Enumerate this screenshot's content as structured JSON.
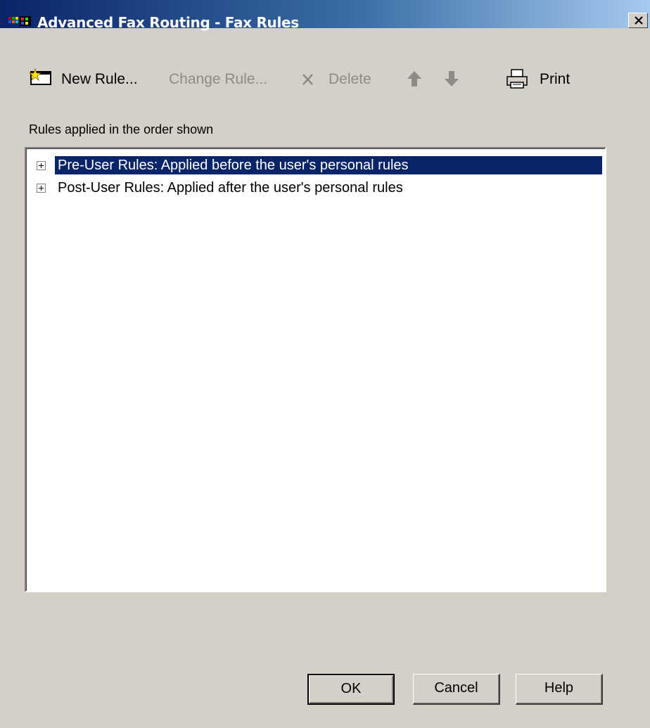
{
  "window": {
    "title": "Advanced Fax Routing - Fax Rules",
    "close_label": "close"
  },
  "toolbar": {
    "new_rule": "New Rule...",
    "change_rule": "Change Rule...",
    "delete": "Delete",
    "print": "Print"
  },
  "caption": "Rules applied in the order shown",
  "tree": {
    "items": [
      {
        "label": "Pre-User Rules: Applied before the user's personal rules",
        "selected": true
      },
      {
        "label": "Post-User Rules: Applied after the user's personal rules",
        "selected": false
      }
    ]
  },
  "buttons": {
    "ok": "OK",
    "cancel": "Cancel",
    "help": "Help"
  },
  "colors": {
    "selection": "#0a246a",
    "face": "#d4d0c8",
    "disabled_text": "#8d8b86"
  },
  "icons": [
    "app-icon",
    "close-icon",
    "new-rule-icon",
    "delete-icon",
    "move-up-icon",
    "move-down-icon",
    "printer-icon",
    "expand-icon"
  ]
}
